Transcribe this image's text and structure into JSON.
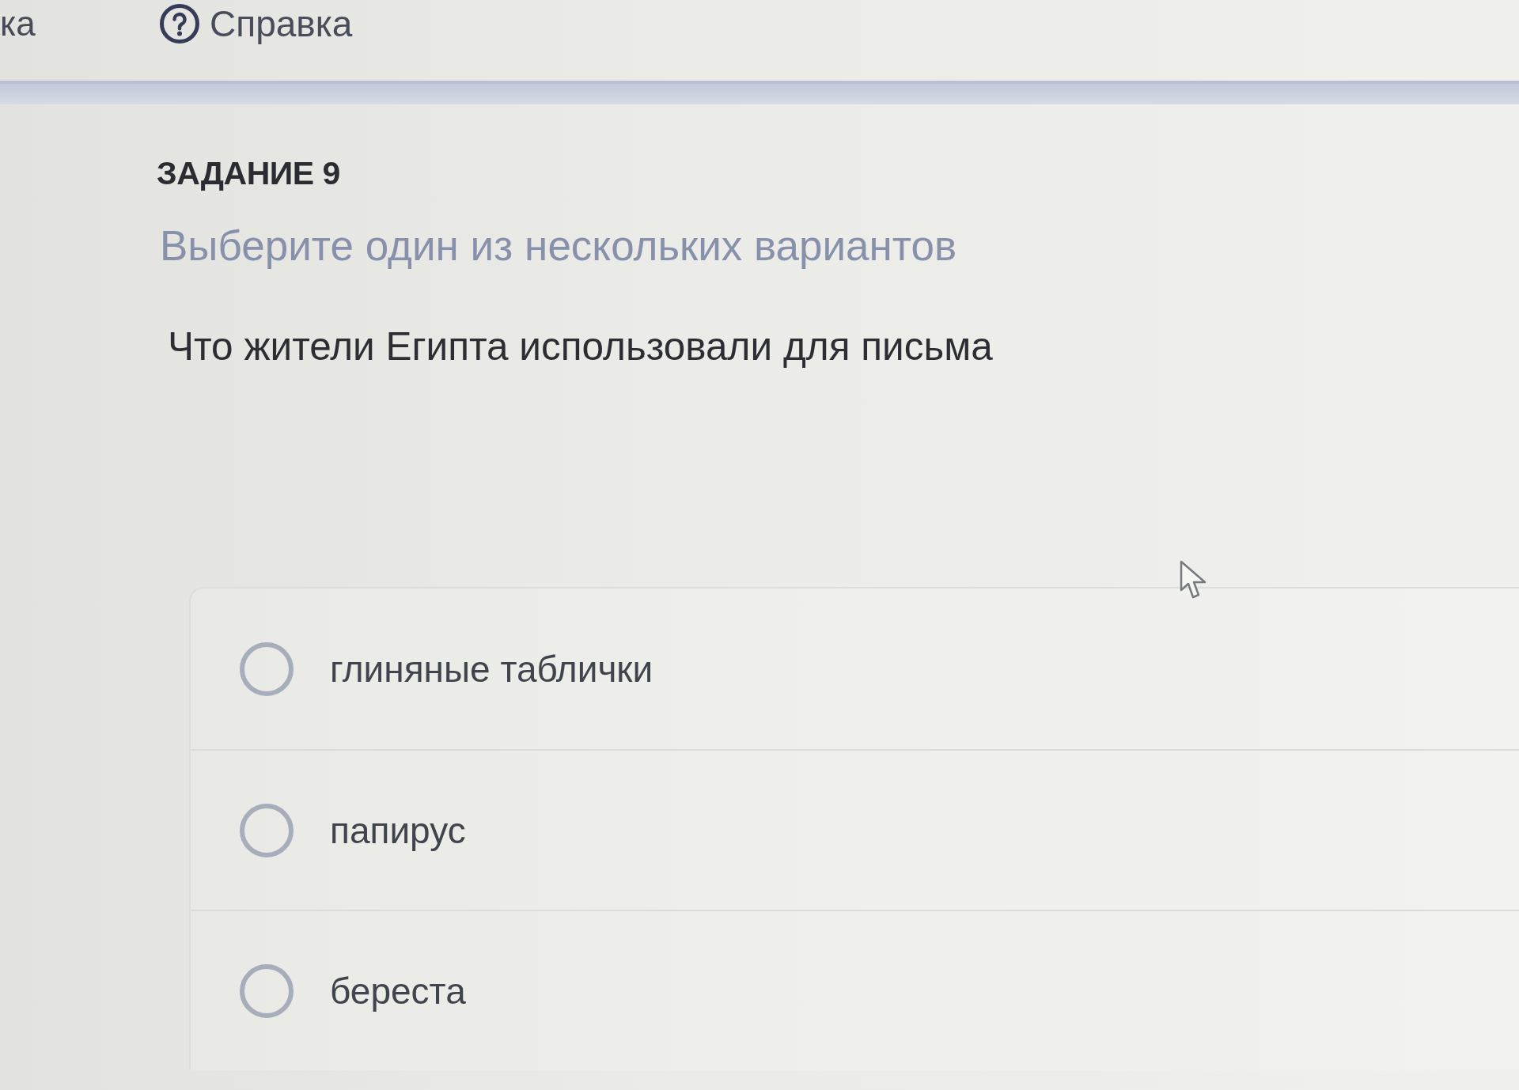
{
  "header": {
    "nav_fragment": "ка",
    "help": {
      "label": "Справка"
    }
  },
  "task": {
    "title": "ЗАДАНИЕ 9",
    "instruction": "Выберите один из нескольких вариантов",
    "question": "Что жители Египта использовали для письма",
    "options": [
      {
        "label": "глиняные таблички",
        "selected": false
      },
      {
        "label": "папирус",
        "selected": false
      },
      {
        "label": "береста",
        "selected": false
      }
    ]
  }
}
